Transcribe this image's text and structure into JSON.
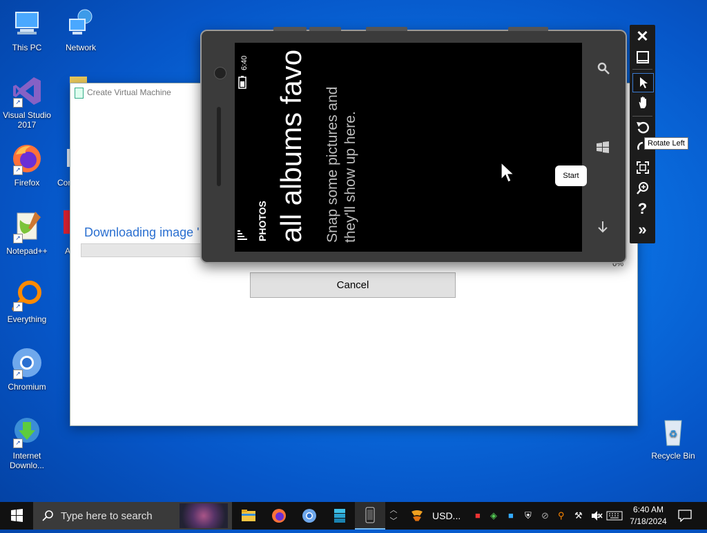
{
  "desktop": {
    "icons": [
      {
        "label": "This PC",
        "icon": "computer-icon"
      },
      {
        "label": "Network",
        "icon": "network-icon"
      },
      {
        "label": "Visual Studio 2017",
        "icon": "visual-studio-icon"
      },
      {
        "label": "Firefox",
        "icon": "firefox-icon"
      },
      {
        "label": "Con",
        "icon": "control-panel-icon"
      },
      {
        "label": "Notepad++",
        "icon": "notepadpp-icon"
      },
      {
        "label": "A",
        "icon": "app-icon"
      },
      {
        "label": "Everything",
        "icon": "everything-icon"
      },
      {
        "label": "Chromium",
        "icon": "chromium-icon"
      },
      {
        "label": "Internet Downlo...",
        "icon": "idm-icon"
      },
      {
        "label": "Recycle Bin",
        "icon": "recycle-bin-icon"
      }
    ]
  },
  "dialog": {
    "title": "Create Virtual Machine",
    "downloading_label": "Downloading image '",
    "percent": "0%",
    "progress": 0,
    "cancel_label": "Cancel"
  },
  "phone": {
    "status_time": "6:40",
    "app_name": "PHOTOS",
    "pivot_title": "all albums favo",
    "hint_line1": "Snap some pictures and",
    "hint_line2": "they'll show up here.",
    "start_bubble": "Start"
  },
  "toolbar": {
    "tooltip": "Rotate Left",
    "buttons": [
      "close",
      "minimize",
      "select",
      "hand",
      "rotate-left",
      "rotate-right",
      "fit",
      "zoom",
      "help",
      "more"
    ]
  },
  "taskbar": {
    "search_placeholder": "Type here to search",
    "tray_app_label": "USD...",
    "time": "6:40 AM",
    "date": "7/18/2024"
  },
  "colors": {
    "accent": "#2a6fd0",
    "taskbar": "#111111",
    "desktop": "#0a6ee0"
  }
}
